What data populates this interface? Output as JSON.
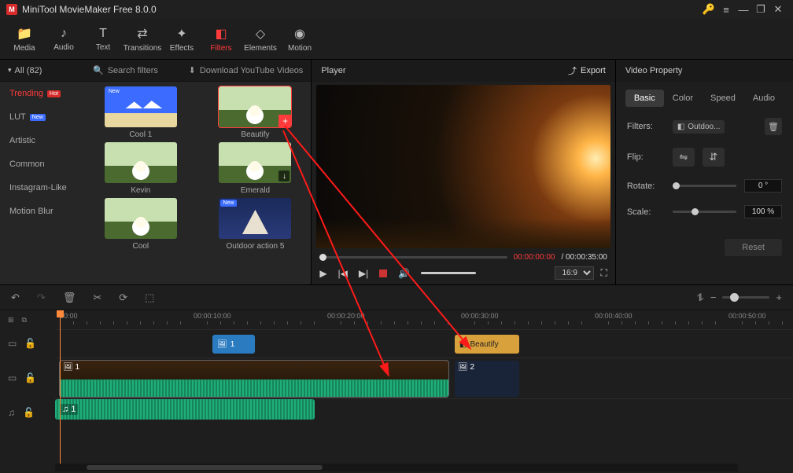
{
  "title": "MiniTool MovieMaker Free 8.0.0",
  "toolbar": [
    {
      "label": "Media",
      "icon": "📁"
    },
    {
      "label": "Audio",
      "icon": "♪"
    },
    {
      "label": "Text",
      "icon": "T"
    },
    {
      "label": "Transitions",
      "icon": "⇄"
    },
    {
      "label": "Effects",
      "icon": "✦"
    },
    {
      "label": "Filters",
      "icon": "◧",
      "active": true
    },
    {
      "label": "Elements",
      "icon": "◇"
    },
    {
      "label": "Motion",
      "icon": "◉"
    }
  ],
  "categories_header": "All (82)",
  "categories": [
    {
      "label": "Trending",
      "badge": "Hot",
      "badgeClass": "hot",
      "active": true
    },
    {
      "label": "LUT",
      "badge": "New",
      "badgeClass": "new"
    },
    {
      "label": "Artistic"
    },
    {
      "label": "Common"
    },
    {
      "label": "Instagram-Like"
    },
    {
      "label": "Motion Blur"
    }
  ],
  "search_placeholder": "Search filters",
  "download_label": "Download YouTube Videos",
  "filters": [
    {
      "label": "Cool 1",
      "new": true,
      "thumb": "beach"
    },
    {
      "label": "Beautify",
      "selected": true,
      "add": true,
      "thumb": "field"
    },
    {
      "label": "Kevin",
      "thumb": "field"
    },
    {
      "label": "Emerald",
      "dl": true,
      "thumb": "field"
    },
    {
      "label": "Cool",
      "thumb": "field"
    },
    {
      "label": "Outdoor action 5",
      "thumb": "camp",
      "new": true
    }
  ],
  "player": {
    "title": "Player",
    "export": "Export",
    "cur": "00:00:00:00",
    "dur": "00:00:35:00",
    "aspect": "16:9"
  },
  "props": {
    "title": "Video Property",
    "tabs": [
      "Basic",
      "Color",
      "Speed",
      "Audio"
    ],
    "filters_label": "Filters:",
    "filter_name": "Outdoo...",
    "flip_label": "Flip:",
    "rotate_label": "Rotate:",
    "rotate_val": "0 °",
    "scale_label": "Scale:",
    "scale_val": "100 %",
    "reset": "Reset"
  },
  "ruler": [
    "00:00",
    "00:00:10:00",
    "00:00:20:00",
    "00:00:30:00",
    "00:00:40:00",
    "00:00:50:00"
  ],
  "timeline": {
    "fx_clip_label": "1",
    "beautify_label": "Beautify",
    "video1_label": "1",
    "video2_label": "2",
    "audio_label": "1"
  }
}
